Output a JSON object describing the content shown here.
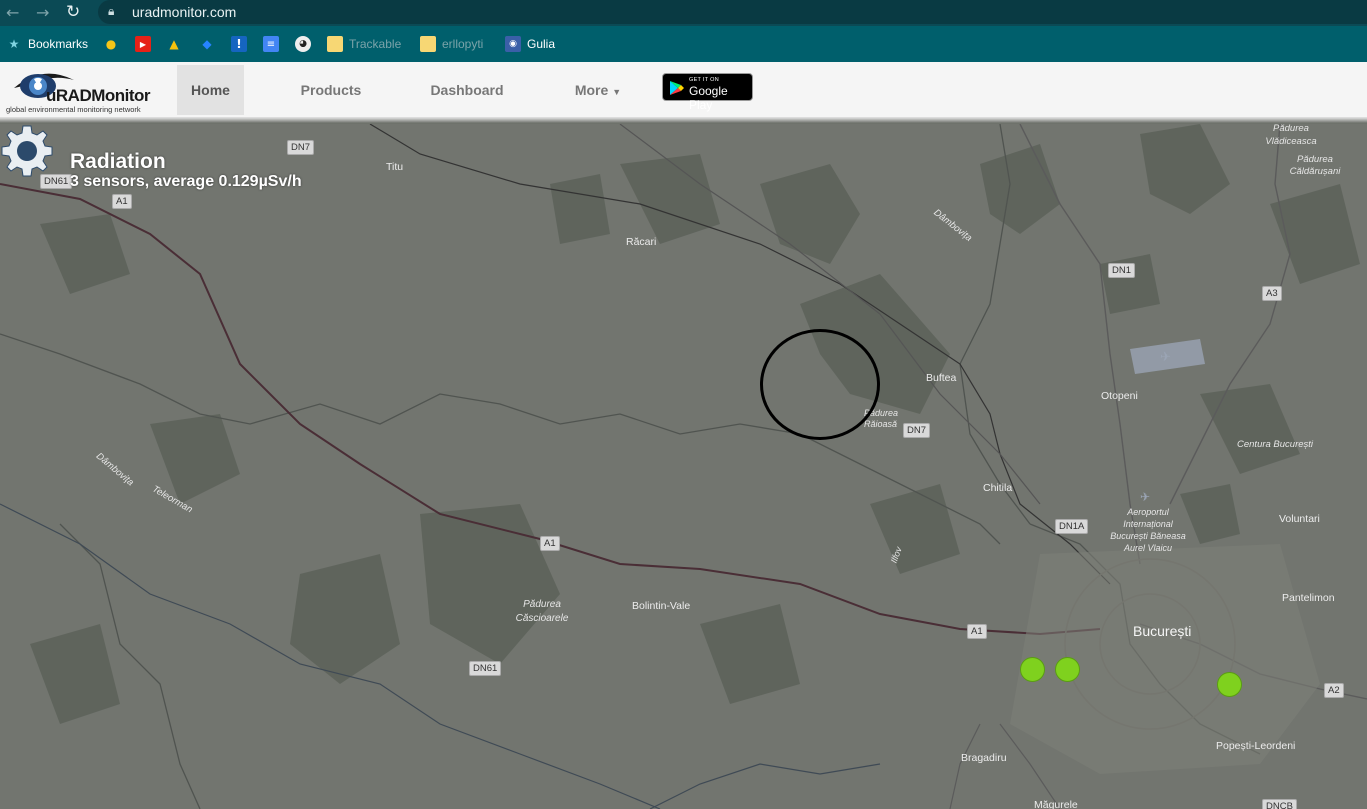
{
  "browser": {
    "url": "uradmonitor.com",
    "bookmarks": [
      {
        "icon": "star-icon",
        "label": "Bookmarks"
      },
      {
        "icon": "bookmark-fruit-icon",
        "label": ""
      },
      {
        "icon": "youtube-icon",
        "label": ""
      },
      {
        "icon": "drive-icon",
        "label": ""
      },
      {
        "icon": "jira-icon",
        "label": ""
      },
      {
        "icon": "alert-icon",
        "label": ""
      },
      {
        "icon": "docs-icon",
        "label": ""
      },
      {
        "icon": "bird-icon",
        "label": ""
      },
      {
        "icon": "folder-icon",
        "label": "Trackable"
      },
      {
        "icon": "folder-icon",
        "label": "erllopyti"
      },
      {
        "icon": "gulia-icon",
        "label": "Gulia"
      }
    ]
  },
  "site": {
    "logo_title": "uRADMonitor",
    "logo_subtitle": "global environmental monitoring network",
    "nav": {
      "home": "Home",
      "products": "Products",
      "dashboard": "Dashboard",
      "more": "More",
      "more_caret": "▼"
    },
    "google_play": {
      "small": "GET IT ON",
      "big": "Google Play"
    }
  },
  "overlay": {
    "title": "Radiation",
    "subtitle": "3 sensors, average 0.129µSv/h"
  },
  "map": {
    "places": {
      "titu": "Titu",
      "racari": "Răcari",
      "buftea": "Buftea",
      "otopeni": "Otopeni",
      "chitila": "Chitila",
      "bolintin": "Bolintin-Vale",
      "bucuresti": "București",
      "voluntari": "Voluntari",
      "pantelimon": "Pantelimon",
      "popesti": "Popești-Leordeni",
      "bragadiru": "Bragadiru",
      "magurele": "Măgurele",
      "centura": "Centura București",
      "padurea_vladiceasca": "Pădurea Vlădiceasca",
      "padurea_caldarusani": "Pădurea Căldărușani",
      "padurea_raioasa": "Pădurea Răioasă",
      "padurea_cascioarele": "Pădurea Căscioarele",
      "dambovita_n": "Dâmbovița",
      "dambovita_w": "Dâmbovița",
      "teleorman": "Teleorman",
      "ilfov": "Ilfov",
      "airport": "Aeroportul Internațional București Băneasa Aurel Vlaicu"
    },
    "roads": {
      "dn7_a": "DN7",
      "dn61_a": "DN61",
      "a1_a": "A1",
      "dn1": "DN1",
      "a3": "A3",
      "dn7_b": "DN7",
      "dn1a": "DN1A",
      "a1_b": "A1",
      "a1_c": "A1",
      "dn61_b": "DN61",
      "a2": "A2",
      "dncb": "DNCB"
    },
    "sensor_color": "#7fd11e",
    "highlight_circle_color": "#000000"
  }
}
